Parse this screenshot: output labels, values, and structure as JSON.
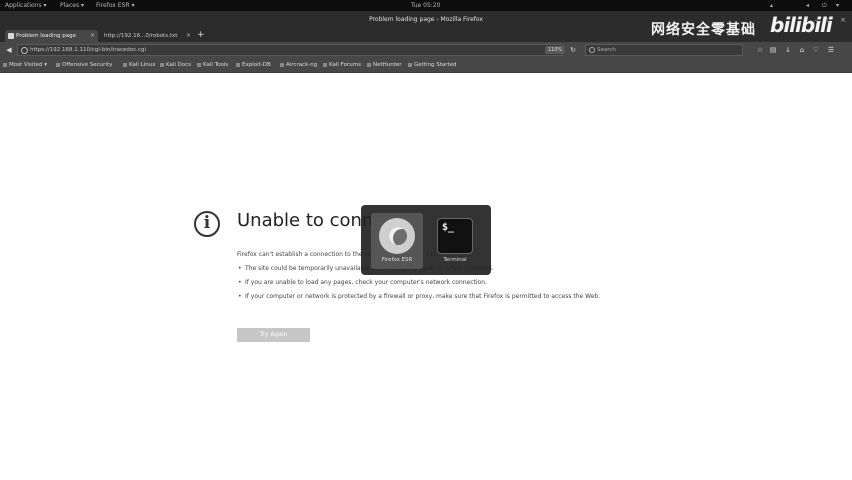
{
  "topbar": {
    "applications": "Applications ▾",
    "places": "Places ▾",
    "app_menu": "Firefox ESR ▾",
    "clock": "Tue 05:20"
  },
  "window": {
    "title": "Problem loading page - Mozilla Firefox"
  },
  "tabs": [
    {
      "label": "Problem loading page",
      "active": true
    },
    {
      "label": "http://192.16...0/robots.txt",
      "active": false
    }
  ],
  "navbar": {
    "url": "https://192.168.1.110/cgi-bin/tracedoc.cgi",
    "zoom": "110%",
    "search_placeholder": "Search"
  },
  "bookmarks": [
    "Most Visited ▾",
    "Offensive Security",
    "Kali Linux",
    "Kali Docs",
    "Kali Tools",
    "Exploit-DB",
    "Aircrack-ng",
    "Kali Forums",
    "NetHunter",
    "Getting Started"
  ],
  "error": {
    "title": "Unable to connect",
    "description": "Firefox can't establish a connection to the server at 192.168.1.110.",
    "bullets": [
      "The site could be temporarily unavailable or too busy. Try again in a few moments.",
      "If you are unable to load any pages, check your computer's network connection.",
      "If your computer or network is protected by a firewall or proxy, make sure that Firefox is permitted to access the Web."
    ],
    "button": "Try Again"
  },
  "switcher": {
    "apps": [
      {
        "label": "Firefox ESR",
        "icon": "firefox-icon",
        "selected": true
      },
      {
        "label": "Terminal",
        "icon": "terminal-icon",
        "selected": false,
        "glyph": "$_"
      }
    ]
  },
  "watermark": {
    "text": "网络安全零基础",
    "logo": "bilibili"
  }
}
